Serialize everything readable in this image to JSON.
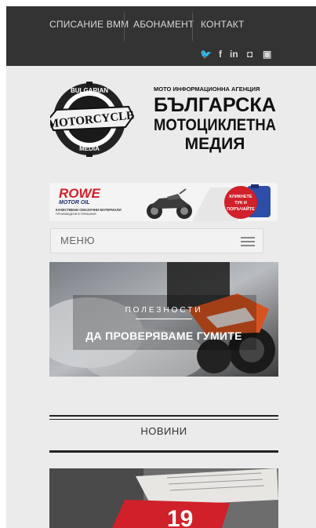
{
  "nav": {
    "items": [
      {
        "label": "СПИСАНИЕ ВММ"
      },
      {
        "label": "АБОНАМЕНТ"
      },
      {
        "label": "КОНТАКТ"
      }
    ]
  },
  "social": {
    "twitter": "🐦",
    "facebook": "f",
    "linkedin": "in",
    "instagram": "◘",
    "youtube": "▣"
  },
  "logo": {
    "badge_top": "BULGARIAN",
    "badge_center": "MOTORCYCLE",
    "badge_bottom": "MEDIA",
    "agency": "МОТО ИНФОРМАЦИОННА АГЕНЦИЯ",
    "line1": "БЪЛГАРСКА",
    "line2": "МОТОЦИКЛЕТНА",
    "line3": "МЕДИЯ"
  },
  "banner": {
    "brand": "ROWE",
    "brand_sub": "MOTOR OIL",
    "tagline": "КАЧЕСТВЕНИ СМАЗОЧНИ МАТЕРИАЛИ",
    "tagline2": "ПРОИЗВЕДЕНИ В ГЕРМАНИЯ",
    "cta1": "КЛИКНЕТЕ",
    "cta2": "ТУК И",
    "cta3": "ПОРЪЧАЙТЕ"
  },
  "menu": {
    "label": "МЕНЮ"
  },
  "hero": {
    "category": "ПОЛЕЗНОСТИ",
    "title": "ДА ПРОВЕРЯВАМЕ ГУМИТЕ"
  },
  "news": {
    "heading": "НОВИНИ"
  },
  "post": {
    "badge": "19"
  },
  "colors": {
    "topbar": "#333333",
    "page_bg": "#ebebeb",
    "accent_red": "#d0202a"
  }
}
